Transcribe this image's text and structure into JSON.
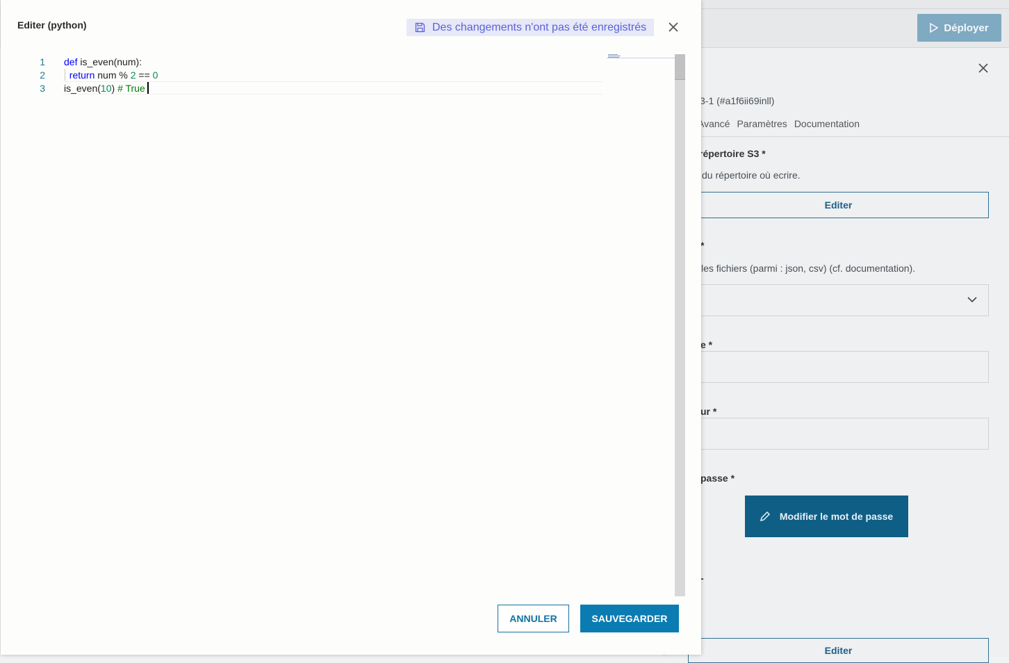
{
  "background": {
    "deploy_label": "Déployer",
    "panel": {
      "node_id": "3-1 (#a1f6ii69inll)",
      "tabs": [
        "Avancé",
        "Paramètres",
        "Documentation"
      ],
      "field1_label": "répertoire S3 *",
      "field1_desc": "du répertoire où ecrire.",
      "edit_label": "Editer",
      "field2_label": "*",
      "field2_desc": "les fichiers (parmi : json, csv) (cf. documentation).",
      "field3_label": "e *",
      "field4_label": "ur *",
      "field5_label": "passe *",
      "password_button": "Modifier le mot de passe",
      "field6_label": "-",
      "edit_label_2": "Editer"
    }
  },
  "modal": {
    "title": "Editer (python)",
    "unsaved_text": "Des changements n'ont pas été enregistrés",
    "editor": {
      "line_numbers": [
        "1",
        "2",
        "3"
      ],
      "lines": [
        "def is_even(num):",
        "  return num % 2 == 0",
        "is_even(10) # True"
      ]
    },
    "cancel_label": "ANNULER",
    "save_label": "SAUVEGARDER"
  },
  "colors": {
    "primary": "#0a7cb2",
    "unsaved_bg": "#e7e8f8",
    "unsaved_fg": "#5a62d6",
    "keyword": "#0000ff",
    "number": "#098658",
    "comment": "#008000"
  },
  "icons": {
    "deploy": "play-icon",
    "unsaved": "floppy-disk-icon",
    "close": "close-icon",
    "select": "chevron-down-icon",
    "password": "pencil-icon"
  }
}
